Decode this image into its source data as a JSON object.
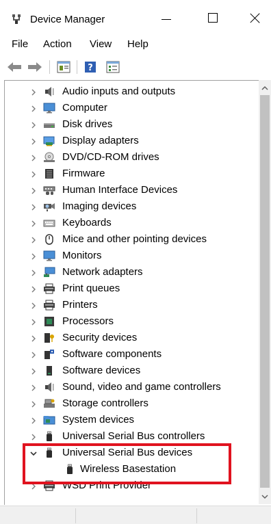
{
  "window": {
    "title": "Device Manager",
    "icon": "device-manager-icon"
  },
  "menu": [
    "File",
    "Action",
    "View",
    "Help"
  ],
  "toolbar": {
    "buttons": [
      "back-arrow-icon",
      "forward-arrow-icon",
      "properties-icon",
      "help-icon",
      "view-icon"
    ]
  },
  "tree": {
    "items": [
      {
        "label": "Audio inputs and outputs",
        "icon": "speaker-icon",
        "expanded": false
      },
      {
        "label": "Computer",
        "icon": "monitor-icon",
        "expanded": false
      },
      {
        "label": "Disk drives",
        "icon": "disk-drive-icon",
        "expanded": false
      },
      {
        "label": "Display adapters",
        "icon": "display-adapter-icon",
        "expanded": false
      },
      {
        "label": "DVD/CD-ROM drives",
        "icon": "dvd-icon",
        "expanded": false
      },
      {
        "label": "Firmware",
        "icon": "firmware-icon",
        "expanded": false
      },
      {
        "label": "Human Interface Devices",
        "icon": "hid-icon",
        "expanded": false
      },
      {
        "label": "Imaging devices",
        "icon": "camera-icon",
        "expanded": false
      },
      {
        "label": "Keyboards",
        "icon": "keyboard-icon",
        "expanded": false
      },
      {
        "label": "Mice and other pointing devices",
        "icon": "mouse-icon",
        "expanded": false
      },
      {
        "label": "Monitors",
        "icon": "monitor-icon",
        "expanded": false
      },
      {
        "label": "Network adapters",
        "icon": "network-icon",
        "expanded": false
      },
      {
        "label": "Print queues",
        "icon": "printer-icon",
        "expanded": false
      },
      {
        "label": "Printers",
        "icon": "printer-icon",
        "expanded": false
      },
      {
        "label": "Processors",
        "icon": "processor-icon",
        "expanded": false
      },
      {
        "label": "Security devices",
        "icon": "security-icon",
        "expanded": false
      },
      {
        "label": "Software components",
        "icon": "software-component-icon",
        "expanded": false
      },
      {
        "label": "Software devices",
        "icon": "software-device-icon",
        "expanded": false
      },
      {
        "label": "Sound, video and game controllers",
        "icon": "speaker-icon",
        "expanded": false
      },
      {
        "label": "Storage controllers",
        "icon": "storage-icon",
        "expanded": false
      },
      {
        "label": "System devices",
        "icon": "system-folder-icon",
        "expanded": false
      },
      {
        "label": "Universal Serial Bus controllers",
        "icon": "usb-icon",
        "expanded": false
      },
      {
        "label": "Universal Serial Bus devices",
        "icon": "usb-icon",
        "expanded": true,
        "children": [
          {
            "label": "Wireless Basestation",
            "icon": "usb-icon"
          }
        ]
      },
      {
        "label": "WSD Print Provider",
        "icon": "printer-icon",
        "expanded": false
      }
    ]
  },
  "highlight_color": "#e0131f"
}
